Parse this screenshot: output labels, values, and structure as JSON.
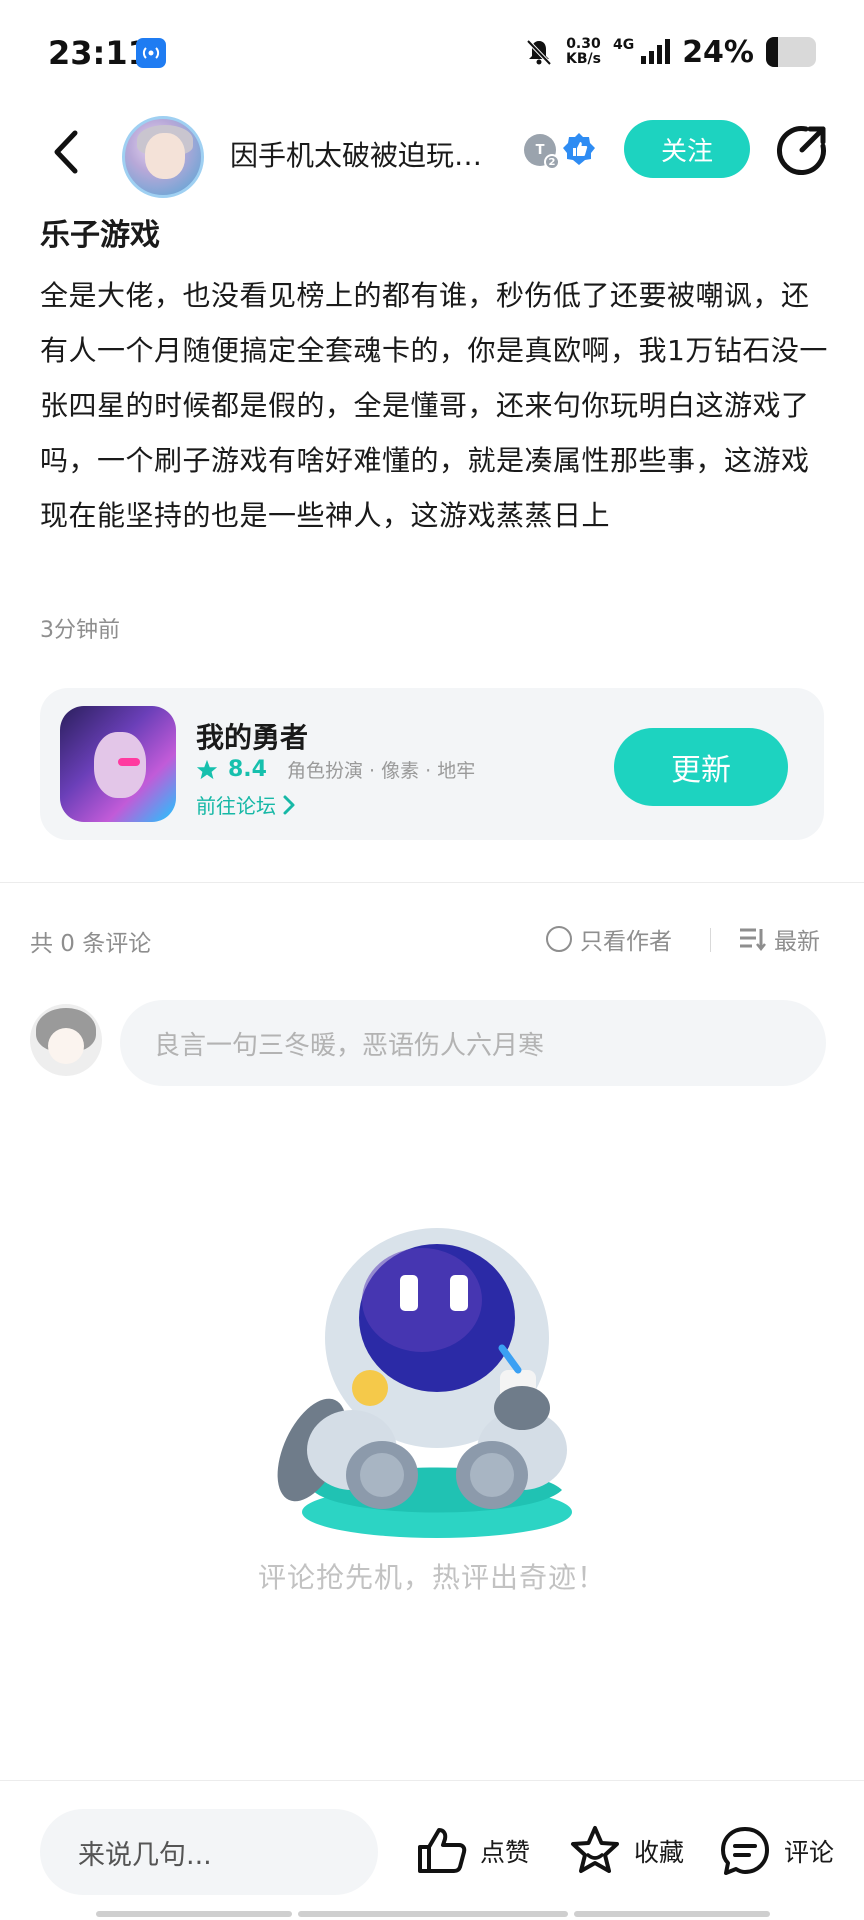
{
  "status_bar": {
    "time": "23:11",
    "net_speed_value": "0.30",
    "net_speed_unit": "KB/s",
    "network": "4G",
    "battery": "24%",
    "battery_level": 0.24
  },
  "header": {
    "author_name": "因手机太破被迫玩…",
    "follow_label": "关注"
  },
  "post": {
    "title": "乐子游戏",
    "body": "全是大佬，也没看见榜上的都有谁，秒伤低了还要被嘲讽，还有人一个月随便搞定全套魂卡的，你是真欧啊，我1万钻石没一张四星的时候都是假的，全是懂哥，还来句你玩明白这游戏了吗，一个刷子游戏有啥好难懂的，就是凑属性那些事，这游戏现在能坚持的也是一些神人，这游戏蒸蒸日上",
    "time": "3分钟前"
  },
  "game_card": {
    "name": "我的勇者",
    "rating": "8.4",
    "tags": "角色扮演 · 像素 · 地牢",
    "forum_link": "前往论坛",
    "update_label": "更新"
  },
  "comments": {
    "count_label": "共 0 条评论",
    "only_author_label": "只看作者",
    "sort_label": "最新",
    "input_placeholder": "良言一句三冬暖，恶语伤人六月寒",
    "empty_text": "评论抢先机，热评出奇迹！"
  },
  "bottom_bar": {
    "say_placeholder": "来说几句...",
    "like_label": "点赞",
    "favorite_label": "收藏",
    "comment_label": "评论"
  },
  "colors": {
    "accent": "#1dd3c0",
    "accent_text": "#16b8a6",
    "muted_text": "#8e8e8e",
    "card_bg": "#f3f5f7"
  }
}
